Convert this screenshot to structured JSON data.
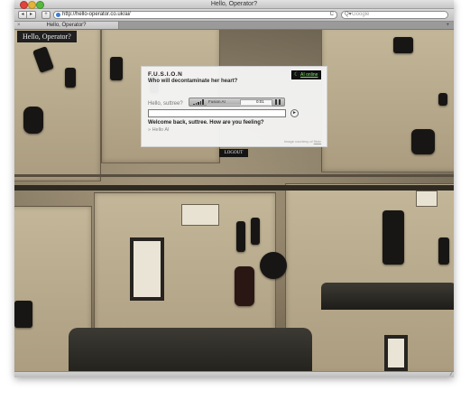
{
  "window": {
    "title": "Hello, Operator?"
  },
  "toolbar": {
    "back_icon": "◂",
    "forward_icon": "▸",
    "add_icon": "+",
    "url": "http://hello-operator.co.uk/ai/",
    "reload_icon": "C",
    "search_placeholder": "Google",
    "search_icon": "Q▾"
  },
  "tabs": [
    {
      "label": "Hello, Operator?",
      "close_icon": "×"
    }
  ],
  "tab_new_icon": "+",
  "site": {
    "title": "Hello, Operator?"
  },
  "fusion": {
    "brand": "F.U.S.I.O.N",
    "tagline": "Who will decontaminate her heart?",
    "status_icon": "moon-icon",
    "status_text": "AI online",
    "greeting": "Hello, suttree?",
    "player": {
      "name": "Fusion AI",
      "time": "0:01",
      "progress": 0.02
    },
    "input_value": "",
    "send_icon": "►",
    "welcome": "Welcome back, suttree. How are you feeling?",
    "user_line": "» Hello AI",
    "credit_prefix": "Image courtesy of",
    "credit_link": "flickr"
  },
  "logout_label": "LOGOUT",
  "colors": {
    "status_green": "#7be06a",
    "progress_green": "#6ac84f",
    "dark": "#141414"
  }
}
